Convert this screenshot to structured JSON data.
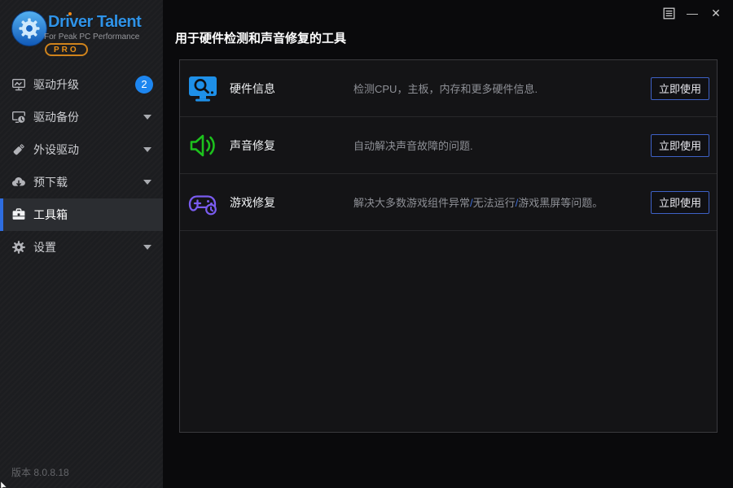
{
  "window": {
    "controls": {
      "minimize": "—",
      "close": "✕"
    }
  },
  "sidebar": {
    "logo": {
      "title": "Driver Talent",
      "tagline": "For Peak PC Performance",
      "badge": "PRO"
    },
    "items": [
      {
        "label": "驱动升级",
        "icon": "monitor-pulse-icon",
        "badge": "2"
      },
      {
        "label": "驱动备份",
        "icon": "monitor-clock-icon"
      },
      {
        "label": "外设驱动",
        "icon": "usb-drive-icon"
      },
      {
        "label": "预下载",
        "icon": "cloud-download-icon"
      },
      {
        "label": "工具箱",
        "icon": "toolbox-icon",
        "selected": true
      },
      {
        "label": "设置",
        "icon": "gear-icon"
      }
    ],
    "version": "版本 8.0.8.18"
  },
  "main": {
    "title": "用于硬件检测和声音修复的工具",
    "tools": [
      {
        "name": "硬件信息",
        "icon": "hardware-info-icon",
        "description": "检测CPU，主板，内存和更多硬件信息.",
        "action": "立即使用"
      },
      {
        "name": "声音修复",
        "icon": "sound-repair-icon",
        "description": "自动解决声音故障的问题.",
        "action": "立即使用"
      },
      {
        "name": "游戏修复",
        "icon": "game-repair-icon",
        "description_segments": [
          "解决大多数游戏组件异常",
          "/",
          "无法运行",
          "/",
          "游戏黑屏等问题。"
        ],
        "action": "立即使用"
      }
    ]
  },
  "colors": {
    "accent_blue": "#1e90e8",
    "sound_green": "#1dc11d",
    "game_purple": "#7a5cf0",
    "badge_blue": "#1d86f0",
    "button_border": "#3e61c6",
    "pro_orange": "#e89018",
    "logo_blue": "#2f93e8",
    "selected_bar_blue": "#2e6de0"
  }
}
